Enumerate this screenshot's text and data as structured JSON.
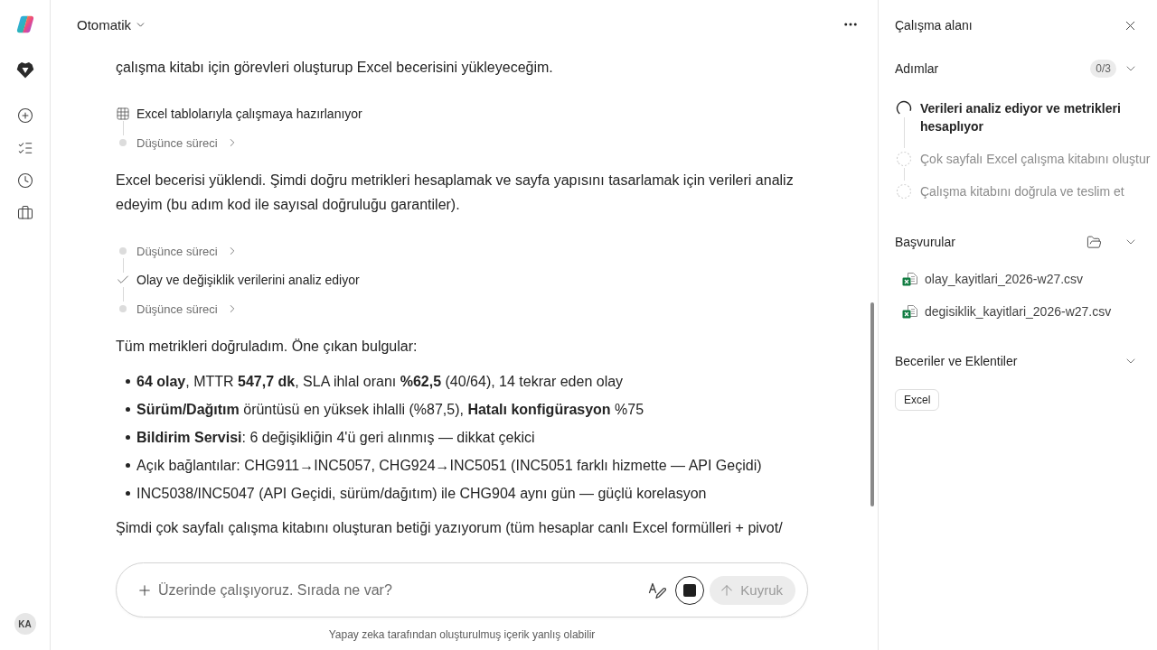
{
  "sidebar": {
    "avatar": "KA"
  },
  "header": {
    "mode": "Otomatik"
  },
  "conversation": [
    {
      "kind": "paragraph",
      "text": "çalışma kitabı için görevleri oluşturup Excel becerisini yükleyeceğim."
    },
    {
      "kind": "trace",
      "entries": [
        {
          "kind": "tool",
          "text": "Excel tablolarıyla çalışmaya hazırlanıyor"
        },
        {
          "kind": "thinking",
          "text": "Düşünce süreci"
        }
      ]
    },
    {
      "kind": "paragraph",
      "text": "Excel becerisi yüklendi. Şimdi doğru metrikleri hesaplamak ve sayfa yapısını tasarlamak için verileri analiz edeyim (bu adım kod ile sayısal doğruluğu garantiler)."
    },
    {
      "kind": "trace",
      "entries": [
        {
          "kind": "thinking",
          "text": "Düşünce süreci"
        },
        {
          "kind": "done",
          "text": "Olay ve değişiklik verilerini analiz ediyor"
        },
        {
          "kind": "thinking",
          "text": "Düşünce süreci"
        }
      ]
    },
    {
      "kind": "paragraph",
      "text": "Tüm metrikleri doğruladım. Öne çıkan bulgular:"
    },
    {
      "kind": "list",
      "items": [
        "**64 olay**, MTTR **547,7 dk**, SLA ihlal oranı **%62,5** (40/64), 14 tekrar eden olay",
        "**Sürüm/Dağıtım** örüntüsü en yüksek ihlalli (%87,5), **Hatalı konfigürasyon** %75",
        "**Bildirim Servisi**: 6 değişikliğin 4'ü geri alınmış — dikkat çekici",
        "Açık bağlantılar: CHG911→INC5057, CHG924→INC5051 (INC5051 farklı hizmette — API Geçidi)",
        "INC5038/INC5047 (API Geçidi, sürüm/dağıtım) ile CHG904 aynı gün — güçlü korelasyon"
      ]
    },
    {
      "kind": "paragraph",
      "text": "Şimdi çok sayfalı çalışma kitabını oluşturan betiği yazıyorum (tüm hesaplar canlı Excel formülleri + pivot/"
    }
  ],
  "composer": {
    "placeholder": "Üzerinde çalışıyoruz. Sırada ne var?",
    "queue_button": {
      "label": "Kuyruk",
      "disabled": true
    }
  },
  "disclaimer": "Yapay zeka tarafından oluşturulmuş içerik yanlış olabilir",
  "workspace": {
    "title": "Çalışma alanı",
    "steps": {
      "title": "Adımlar",
      "count": "0/3",
      "items": [
        {
          "text": "Verileri analiz ediyor ve metrikleri hesaplıyor",
          "active": true
        },
        {
          "text": "Çok sayfalı Excel çalışma kitabını oluştur",
          "active": false
        },
        {
          "text": "Çalışma kitabını doğrula ve teslim et",
          "active": false
        }
      ]
    },
    "references": {
      "title": "Başvurular",
      "files": [
        "olay_kayitlari_2026-w27.csv",
        "degisiklik_kayitlari_2026-w27.csv"
      ]
    },
    "skills": {
      "title": "Beceriler ve Eklentiler",
      "chips": [
        "Excel"
      ]
    }
  }
}
